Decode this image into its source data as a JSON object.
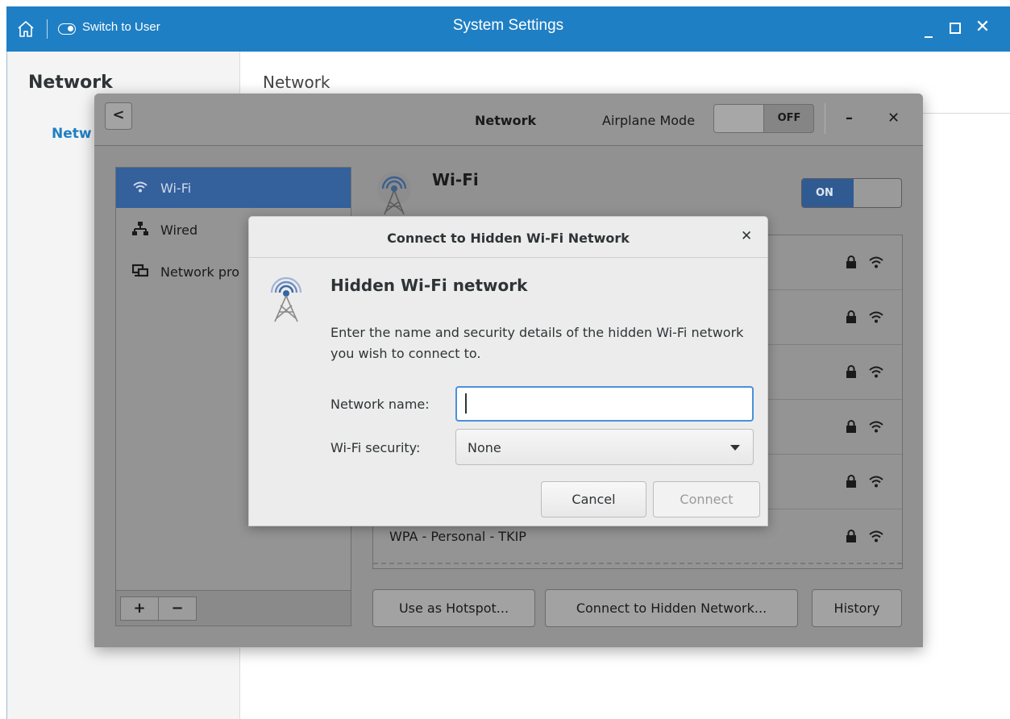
{
  "titlebar": {
    "switch_label": "Switch to User",
    "title": "System Settings"
  },
  "settings_sidebar": {
    "heading": "Network",
    "item": "Netw"
  },
  "settings_main": {
    "heading": "Network"
  },
  "network_dialog": {
    "title": "Network",
    "airplane_label": "Airplane Mode",
    "airplane_state": "OFF",
    "sidebar_items": [
      {
        "label": "Wi-Fi",
        "icon": "wifi-icon",
        "selected": true
      },
      {
        "label": "Wired",
        "icon": "wired-network-icon",
        "selected": false
      },
      {
        "label": "Network pro",
        "icon": "network-proxy-icon",
        "selected": false
      }
    ],
    "add_label": "+",
    "remove_label": "−",
    "wifi_title": "Wi-Fi",
    "wifi_state": "ON",
    "networks": [
      {
        "name": "",
        "secured": true
      },
      {
        "name": "",
        "secured": true
      },
      {
        "name": "",
        "secured": true
      },
      {
        "name": "",
        "secured": true
      },
      {
        "name": "",
        "secured": true
      },
      {
        "name": "WPA - Personal - TKIP",
        "secured": true
      }
    ],
    "buttons": {
      "hotspot": "Use as Hotspot...",
      "hidden": "Connect to Hidden Network...",
      "history": "History"
    }
  },
  "hidden_wifi_modal": {
    "title": "Connect to Hidden Wi-Fi Network",
    "heading": "Hidden Wi-Fi network",
    "description": "Enter the name and security details of the hidden Wi-Fi network you wish to connect to.",
    "network_name_label": "Network name:",
    "network_name_value": "",
    "security_label": "Wi-Fi security:",
    "security_value": "None",
    "cancel_label": "Cancel",
    "connect_label": "Connect"
  },
  "colors": {
    "titlebar": "#1f7fc4",
    "accent": "#1f7fc4",
    "selection_dimmed": "#34609c",
    "focus_ring": "#4a90d9"
  }
}
